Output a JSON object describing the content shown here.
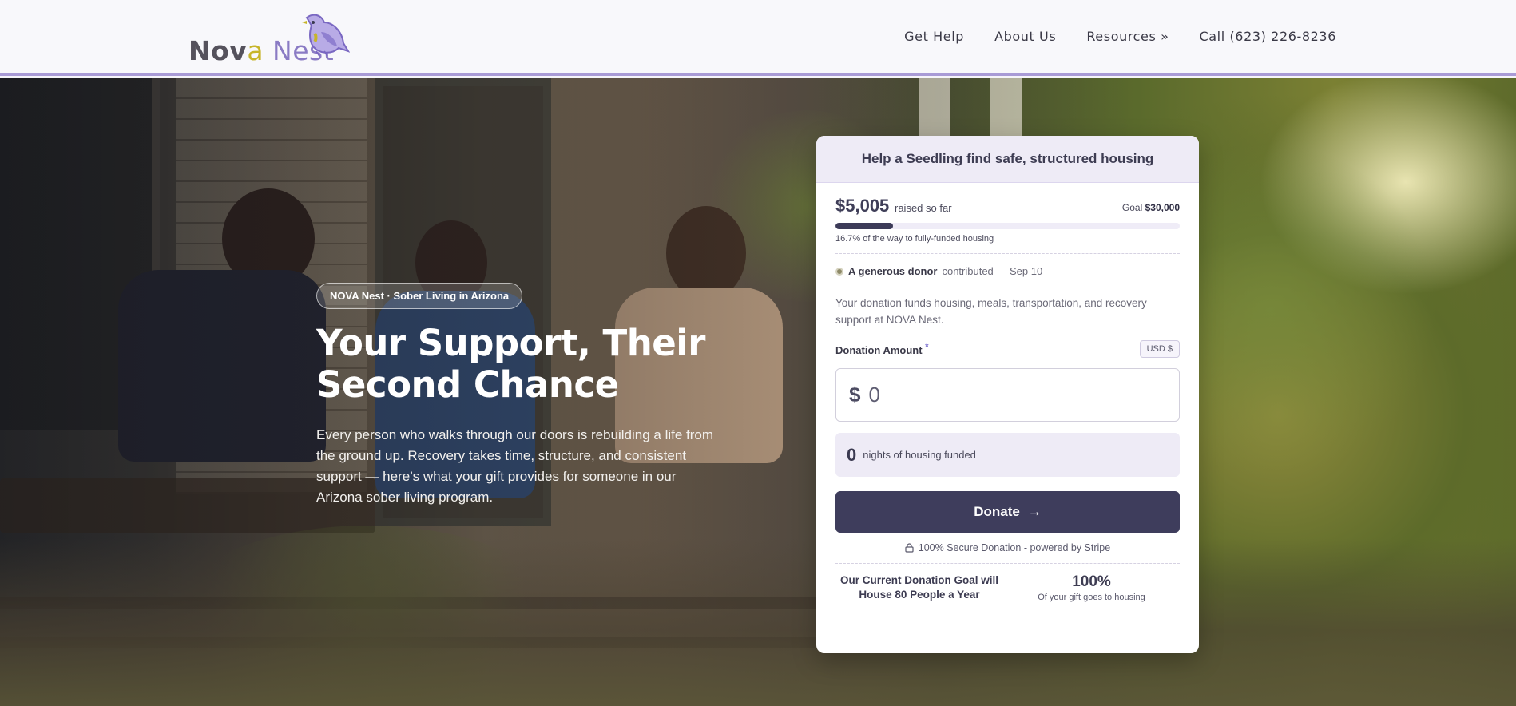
{
  "header": {
    "logo_nova": "Nov",
    "logo_a": "a",
    "logo_nest": "Nest",
    "nav": [
      "Get Help",
      "About Us",
      "Resources »",
      "Call (623) 226-8236"
    ]
  },
  "hero": {
    "badge": "NOVA Nest · Sober Living in Arizona",
    "title": "Your Support, Their Second Chance",
    "body": "Every person who walks through our doors is rebuilding a life from the ground up. Recovery takes time, structure, and consistent support — here’s what your gift provides for someone in our Arizona sober living program."
  },
  "donation_card": {
    "heading": "Help a Seedling find safe, structured housing",
    "raised_amount": "$5,005",
    "raised_label": "raised so far",
    "goal_label": "Goal",
    "goal_amount": "$30,000",
    "progress_fraction": 0.167,
    "progress_note": "16.7% of the way to fully-funded housing",
    "donor_name": "A generous donor",
    "donor_activity": "contributed — Sep 10",
    "fund_note": "Your donation funds housing, meals, transportation, and recovery support at NOVA Nest.",
    "amount_label": "Donation Amount",
    "required_mark": "*",
    "currency": "USD $",
    "currency_symbol": "$",
    "amount_placeholder": "0",
    "nights_value": "0",
    "nights_label": "nights of housing funded",
    "donate_label": "Donate",
    "donate_arrow": "→",
    "secure_label": "100% Secure Donation - powered by Stripe",
    "goal_statement": "Our Current Donation Goal will House 80 People a Year",
    "percent_big": "100%",
    "percent_label": "Of your gift goes to housing"
  },
  "colors": {
    "accent": "#3e3d5c",
    "lavender": "#eeebf6",
    "header_border": "#a99bd6",
    "logo_gold": "#c7b52a"
  },
  "icons": [
    "bird-logo-icon",
    "lock-icon",
    "arrow-right-icon"
  ]
}
